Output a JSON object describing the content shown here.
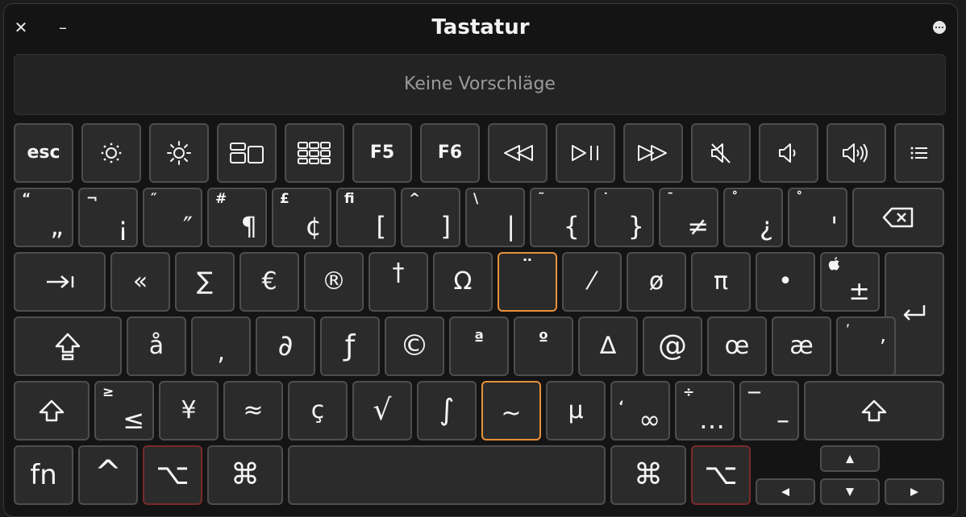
{
  "window": {
    "title": "Tastatur",
    "close_label": "✕",
    "minimize_label": "–"
  },
  "suggestions": {
    "text": "Keine Vorschläge"
  },
  "rows": {
    "fkeys": {
      "esc": "esc",
      "f5": "F5",
      "f6": "F6"
    },
    "numbers": [
      {
        "top": "“",
        "main": "„"
      },
      {
        "top": "¬",
        "main": "¡"
      },
      {
        "top": "″",
        "main": "″"
      },
      {
        "top": "#",
        "main": "¶"
      },
      {
        "top": "£",
        "main": "¢"
      },
      {
        "top": "ﬁ",
        "main": "["
      },
      {
        "top": "^",
        "main": "]"
      },
      {
        "top": "\\",
        "main": "|"
      },
      {
        "top": "˜",
        "main": "{"
      },
      {
        "top": "˙",
        "main": "}"
      },
      {
        "top": "¯",
        "main": "≠"
      },
      {
        "top": "˚",
        "main": "¿"
      },
      {
        "top": "˚",
        "main": "'"
      }
    ],
    "qwerty": [
      "«",
      "∑",
      "€",
      "®",
      "†",
      "Ω",
      "¨",
      "⁄",
      "ø",
      "π",
      "•",
      "±"
    ],
    "qwerty_top_last": "",
    "home": [
      "å",
      "‚",
      "∂",
      "ƒ",
      "©",
      "ª",
      "º",
      "∆",
      "@",
      "œ",
      "æ",
      "’"
    ],
    "home_top_last": "ʹ",
    "bottom": [
      {
        "top": "≥",
        "main": "≤"
      },
      {
        "top": "",
        "main": "¥"
      },
      {
        "top": "",
        "main": "≈"
      },
      {
        "top": "",
        "main": "ç"
      },
      {
        "top": "",
        "main": "√"
      },
      {
        "top": "",
        "main": "∫"
      },
      {
        "top": "",
        "main": "~"
      },
      {
        "top": "",
        "main": "µ"
      },
      {
        "top": "‘",
        "main": "∞"
      },
      {
        "top": "÷",
        "main": "…"
      },
      {
        "top": "—",
        "main": "–"
      }
    ],
    "modifiers": {
      "fn": "fn",
      "ctrl": "^",
      "option": "⌥",
      "command": "⌘"
    },
    "arrows": {
      "up": "▲",
      "down": "▼",
      "left": "◀",
      "right": "▶"
    }
  },
  "colors": {
    "highlight": "#e8913a",
    "option_border": "#7a2a2a"
  }
}
